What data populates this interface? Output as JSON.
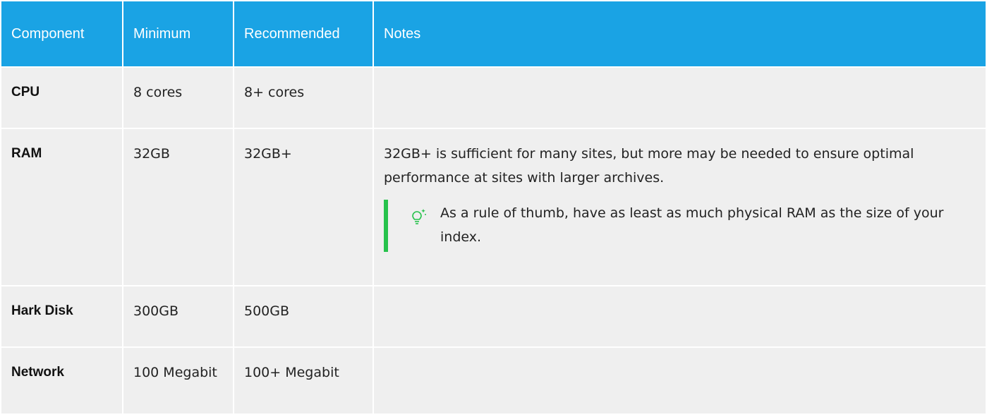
{
  "headers": [
    "Component",
    "Minimum",
    "Recommended",
    "Notes"
  ],
  "rows": [
    {
      "component": "CPU",
      "minimum": "8 cores",
      "recommended": "8+ cores",
      "notes": ""
    },
    {
      "component": "RAM",
      "minimum": "32GB",
      "recommended": "32GB+",
      "notes": "32GB+ is sufficient for many sites, but more may be needed to ensure optimal performance at sites with larger archives.",
      "tip": "As a rule of thumb, have as least as much physical RAM as the size of your index."
    },
    {
      "component": "Hark Disk",
      "minimum": "300GB",
      "recommended": "500GB",
      "notes": ""
    },
    {
      "component": "Network",
      "minimum": "100 Megabit",
      "recommended": "100+ Megabit",
      "notes": ""
    }
  ],
  "colors": {
    "header_bg": "#1aa3e4",
    "cell_bg": "#efefef",
    "tip_accent": "#27c24c"
  },
  "icons": {
    "tip": "lightbulb-icon"
  }
}
